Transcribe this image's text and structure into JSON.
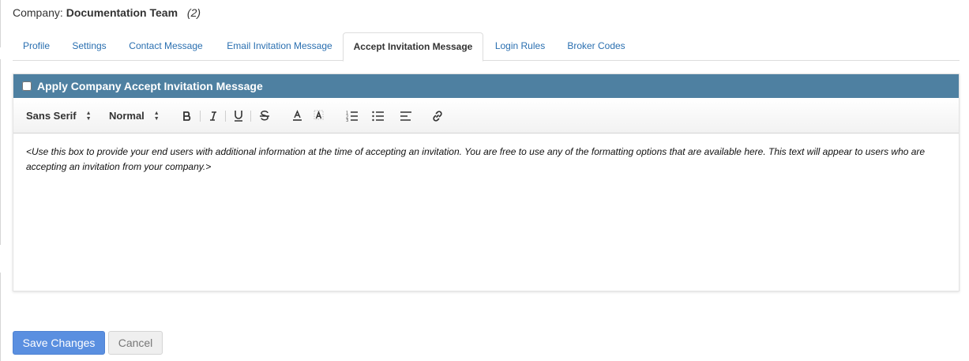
{
  "company": {
    "label": "Company:",
    "name": "Documentation Team",
    "count": "(2)"
  },
  "tabs": [
    {
      "label": "Profile",
      "active": false
    },
    {
      "label": "Settings",
      "active": false
    },
    {
      "label": "Contact Message",
      "active": false
    },
    {
      "label": "Email Invitation Message",
      "active": false
    },
    {
      "label": "Accept Invitation Message",
      "active": true
    },
    {
      "label": "Login Rules",
      "active": false
    },
    {
      "label": "Broker Codes",
      "active": false
    }
  ],
  "panel": {
    "title": "Apply Company Accept Invitation Message",
    "checkbox_checked": false
  },
  "toolbar": {
    "font_select": "Sans Serif",
    "size_select": "Normal",
    "icons": [
      "bold-icon",
      "italic-icon",
      "underline-icon",
      "strikethrough-icon",
      "text-color-icon",
      "background-color-icon",
      "ordered-list-icon",
      "bullet-list-icon",
      "align-left-icon",
      "link-icon"
    ]
  },
  "editor": {
    "text": "<Use this box to provide your end users with additional information at the time of accepting an invitation. You are free to use any of the formatting options that are available here. This text will appear to users who are accepting an invitation from your company.>"
  },
  "buttons": {
    "save": "Save Changes",
    "cancel": "Cancel"
  },
  "colors": {
    "link": "#2a6fb0",
    "panel_header": "#4e80a1",
    "primary_button": "#5a8fe0"
  }
}
